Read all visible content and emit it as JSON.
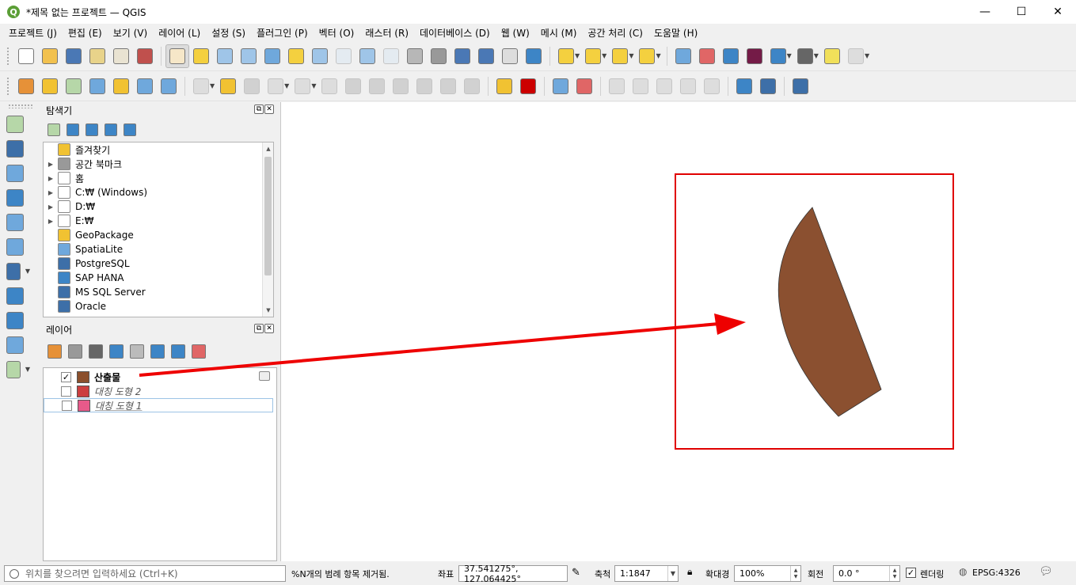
{
  "window": {
    "title": "*제목 없는 프로젝트 — QGIS",
    "app_icon_letter": "Q",
    "controls": {
      "minimize": "—",
      "maximize": "☐",
      "close": "✕"
    }
  },
  "menubar": [
    "프로젝트 (J)",
    "편집 (E)",
    "보기 (V)",
    "레이어 (L)",
    "설정 (S)",
    "플러그인 (P)",
    "벡터 (O)",
    "래스터 (R)",
    "데이터베이스 (D)",
    "웹 (W)",
    "메시 (M)",
    "공간 처리 (C)",
    "도움말 (H)"
  ],
  "toolbar1": [
    {
      "name": "new-project-icon",
      "color": "#ffffff"
    },
    {
      "name": "open-project-icon",
      "color": "#f2c14e"
    },
    {
      "name": "save-project-icon",
      "color": "#4a78b5"
    },
    {
      "name": "new-print-layout-icon",
      "color": "#e8d38a"
    },
    {
      "name": "layout-manager-icon",
      "color": "#e9e3d2"
    },
    {
      "name": "style-manager-icon",
      "color": "#c0504d"
    },
    {
      "name": "sep"
    },
    {
      "name": "pan-map-icon",
      "color": "#f6e7c8",
      "active": true
    },
    {
      "name": "pan-to-selection-icon",
      "color": "#f4d03f"
    },
    {
      "name": "zoom-in-icon",
      "color": "#9fc5e8"
    },
    {
      "name": "zoom-out-icon",
      "color": "#9fc5e8"
    },
    {
      "name": "zoom-full-icon",
      "color": "#6fa8dc"
    },
    {
      "name": "zoom-to-selection-icon",
      "color": "#f4d03f"
    },
    {
      "name": "zoom-to-layer-icon",
      "color": "#9fc5e8"
    },
    {
      "name": "zoom-native-icon",
      "color": "#cfe2f3",
      "dim": true
    },
    {
      "name": "zoom-last-icon",
      "color": "#9fc5e8"
    },
    {
      "name": "zoom-next-icon",
      "color": "#cfe2f3",
      "dim": true
    },
    {
      "name": "new-map-view-icon",
      "color": "#b7b7b7"
    },
    {
      "name": "new-3d-view-icon",
      "color": "#999999"
    },
    {
      "name": "new-bookmark-icon",
      "color": "#4a78b5"
    },
    {
      "name": "show-bookmarks-icon",
      "color": "#4a78b5"
    },
    {
      "name": "temporal-controller-icon",
      "color": "#dddddd"
    },
    {
      "name": "refresh-icon",
      "color": "#3d85c6"
    },
    {
      "name": "sep"
    },
    {
      "name": "select-features-icon",
      "color": "#f4d03f",
      "dd": true
    },
    {
      "name": "select-by-value-icon",
      "color": "#f4d03f",
      "dd": true
    },
    {
      "name": "deselect-all-icon",
      "color": "#f4d03f",
      "dd": true
    },
    {
      "name": "select-location-icon",
      "color": "#f4d03f",
      "dd": true
    },
    {
      "name": "sep"
    },
    {
      "name": "identify-features-icon",
      "color": "#6fa8dc"
    },
    {
      "name": "attribute-table-icon",
      "color": "#e06666"
    },
    {
      "name": "toolbox-icon",
      "color": "#3d85c6"
    },
    {
      "name": "statistics-sigma-icon",
      "color": "#741b47"
    },
    {
      "name": "field-calculator-icon",
      "color": "#3d85c6",
      "dd": true
    },
    {
      "name": "measure-line-icon",
      "color": "#666666",
      "dd": true
    },
    {
      "name": "map-tips-icon",
      "color": "#f1e05a"
    },
    {
      "name": "locator-search-icon",
      "color": "#bbbbbb",
      "dd": true,
      "dim": true
    }
  ],
  "toolbar2": [
    {
      "name": "add-layers-icon",
      "color": "#e69138"
    },
    {
      "name": "data-source-manager-icon",
      "color": "#f1c232"
    },
    {
      "name": "new-shapefile-icon",
      "color": "#b6d7a8"
    },
    {
      "name": "new-spatialite-icon",
      "color": "#6fa8dc"
    },
    {
      "name": "new-memory-layer-icon",
      "color": "#f1c232"
    },
    {
      "name": "new-virtual-layer-icon",
      "color": "#6fa8dc"
    },
    {
      "name": "new-gpx-layer-icon",
      "color": "#6fa8dc"
    },
    {
      "name": "sep"
    },
    {
      "name": "current-edits-icon",
      "color": "#bbbbbb",
      "dim": true,
      "dd": true
    },
    {
      "name": "toggle-editing-icon",
      "color": "#f1c232"
    },
    {
      "name": "save-edits-icon",
      "color": "#999999",
      "dim": true
    },
    {
      "name": "digitize-icon",
      "color": "#bbbbbb",
      "dim": true,
      "dd": true
    },
    {
      "name": "vertex-tool-icon",
      "color": "#bbbbbb",
      "dim": true,
      "dd": true
    },
    {
      "name": "modify-attributes-icon",
      "color": "#bbbbbb",
      "dim": true
    },
    {
      "name": "delete-selected-icon",
      "color": "#999999",
      "dim": true
    },
    {
      "name": "cut-features-icon",
      "color": "#999999",
      "dim": true
    },
    {
      "name": "copy-features-icon",
      "color": "#999999",
      "dim": true
    },
    {
      "name": "paste-features-icon",
      "color": "#999999",
      "dim": true
    },
    {
      "name": "undo-icon",
      "color": "#999999",
      "dim": true
    },
    {
      "name": "redo-icon",
      "color": "#999999",
      "dim": true
    },
    {
      "name": "sep"
    },
    {
      "name": "layer-labeling-icon",
      "color": "#f1c232"
    },
    {
      "name": "layer-diagram-icon",
      "color": "#cc0000"
    },
    {
      "name": "sep"
    },
    {
      "name": "highlight-pinned-labels-icon",
      "color": "#6fa8dc"
    },
    {
      "name": "pin-labels-icon",
      "color": "#e06666"
    },
    {
      "name": "sep"
    },
    {
      "name": "show-hide-labels-icon",
      "color": "#bbbbbb",
      "dim": true
    },
    {
      "name": "move-label-icon",
      "color": "#bbbbbb",
      "dim": true
    },
    {
      "name": "rotate-label-icon",
      "color": "#bbbbbb",
      "dim": true
    },
    {
      "name": "change-label-icon",
      "color": "#bbbbbb",
      "dim": true
    },
    {
      "name": "label-properties-icon",
      "color": "#bbbbbb",
      "dim": true
    },
    {
      "name": "sep"
    },
    {
      "name": "qgis-network-icon",
      "color": "#3d85c6"
    },
    {
      "name": "python-console-icon",
      "color": "#3d6fa8"
    },
    {
      "name": "sep"
    },
    {
      "name": "help-icon",
      "color": "#3d6fa8"
    }
  ],
  "vtoolbar": [
    {
      "name": "add-vector-layer-icon",
      "color": "#b6d7a8"
    },
    {
      "name": "add-raster-layer-icon",
      "color": "#3d6fa8"
    },
    {
      "name": "add-mesh-layer-icon",
      "color": "#6fa8dc"
    },
    {
      "name": "add-delimited-text-icon",
      "color": "#3d85c6"
    },
    {
      "name": "add-spatialite-layer-icon",
      "color": "#6fa8dc"
    },
    {
      "name": "add-virtual-layer-icon",
      "color": "#6fa8dc"
    },
    {
      "name": "add-postgis-layer-icon",
      "color": "#3d6fa8",
      "dd": true
    },
    {
      "name": "add-wms-layer-icon",
      "color": "#3d85c6"
    },
    {
      "name": "add-wfs-layer-icon",
      "color": "#3d85c6"
    },
    {
      "name": "add-wcs-layer-icon",
      "color": "#6fa8dc"
    },
    {
      "name": "new-vector-layer-icon",
      "color": "#b6d7a8",
      "dd": true
    }
  ],
  "browser": {
    "title": "탐색기",
    "tools": [
      {
        "name": "add-selected-layers-icon",
        "color": "#b6d7a8"
      },
      {
        "name": "refresh-browser-icon",
        "color": "#3d85c6"
      },
      {
        "name": "filter-browser-icon",
        "color": "#3d85c6"
      },
      {
        "name": "collapse-all-icon",
        "color": "#3d85c6"
      },
      {
        "name": "properties-info-icon",
        "color": "#3d85c6"
      }
    ],
    "items": [
      {
        "label": "즐겨찾기",
        "icon": "star-icon",
        "color": "#f1c232",
        "arrow": ""
      },
      {
        "label": "공간 북마크",
        "icon": "bookmark-icon",
        "color": "#999999",
        "arrow": "▶"
      },
      {
        "label": "홈",
        "icon": "home-icon",
        "color": "#ffffff",
        "arrow": "▶"
      },
      {
        "label": "C:₩ (Windows)",
        "icon": "folder-icon",
        "color": "#ffffff",
        "arrow": "▶"
      },
      {
        "label": "D:₩",
        "icon": "folder-icon",
        "color": "#ffffff",
        "arrow": "▶"
      },
      {
        "label": "E:₩",
        "icon": "folder-icon",
        "color": "#ffffff",
        "arrow": "▶"
      },
      {
        "label": "GeoPackage",
        "icon": "geopackage-icon",
        "color": "#f1c232",
        "arrow": ""
      },
      {
        "label": "SpatiaLite",
        "icon": "spatialite-icon",
        "color": "#6fa8dc",
        "arrow": ""
      },
      {
        "label": "PostgreSQL",
        "icon": "postgresql-icon",
        "color": "#3d6fa8",
        "arrow": ""
      },
      {
        "label": "SAP HANA",
        "icon": "sap-hana-icon",
        "color": "#3d85c6",
        "arrow": ""
      },
      {
        "label": "MS SQL Server",
        "icon": "mssql-icon",
        "color": "#3d6fa8",
        "arrow": ""
      },
      {
        "label": "Oracle",
        "icon": "oracle-icon",
        "color": "#3d6fa8",
        "arrow": ""
      }
    ]
  },
  "layers": {
    "title": "레이어",
    "tools": [
      {
        "name": "open-styling-icon",
        "color": "#e69138"
      },
      {
        "name": "add-group-icon",
        "color": "#999999"
      },
      {
        "name": "manage-map-themes-icon",
        "color": "#666666"
      },
      {
        "name": "filter-legend-icon",
        "color": "#3d85c6"
      },
      {
        "name": "filter-by-expression-icon",
        "color": "#bbbbbb"
      },
      {
        "name": "expand-all-icon",
        "color": "#3d85c6"
      },
      {
        "name": "collapse-all-layers-icon",
        "color": "#3d85c6"
      },
      {
        "name": "remove-layer-icon",
        "color": "#e06666"
      }
    ],
    "items": [
      {
        "label": "산출물",
        "checked": true,
        "swatch": "#8b4f2c",
        "style": "bold",
        "check_mark": "✓"
      },
      {
        "label": "대칭 도형 2",
        "checked": false,
        "swatch": "#cc3f3f",
        "style": "ital",
        "check_mark": ""
      },
      {
        "label": "대칭 도형 1",
        "checked": false,
        "swatch": "#e75a8a",
        "style": "ital-under",
        "check_mark": ""
      }
    ]
  },
  "map": {
    "shape_fill": "#8b5030",
    "frame_color": "#e00000",
    "arrow_color": "#ee0000"
  },
  "status": {
    "locator_placeholder": "위치를 찾으려면 입력하세요 (Ctrl+K)",
    "message": "%N개의 범례 항목 제거됨.",
    "coord_label": "좌표",
    "coord_value": "37.541275°, 127.064425°",
    "scale_label": "축척",
    "scale_value": "1:1847",
    "magnifier_label": "확대경",
    "magnifier_value": "100%",
    "rotation_label": "회전",
    "rotation_value": "0.0 °",
    "render_label": "렌더링",
    "render_checked": "✓",
    "crs": "EPSG:4326"
  }
}
